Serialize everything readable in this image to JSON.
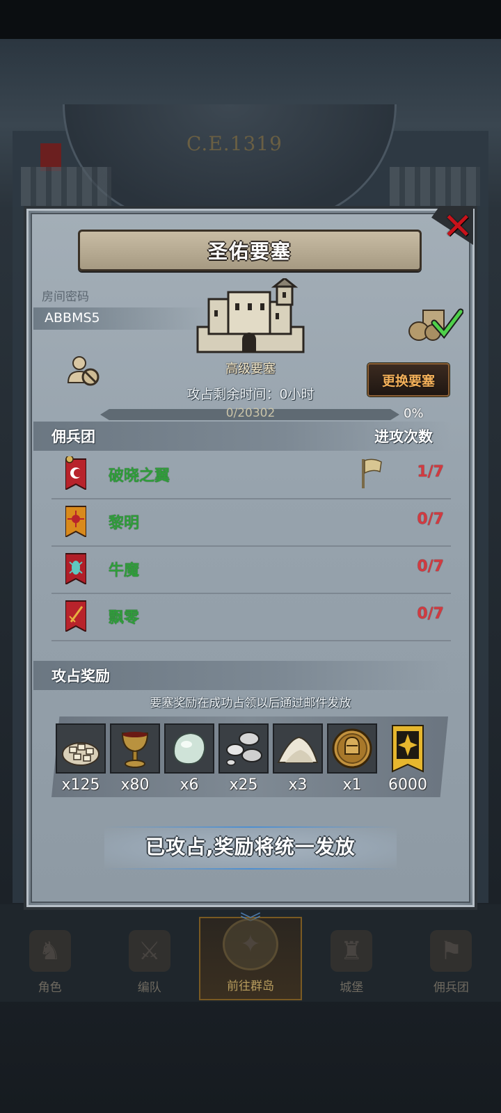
{
  "background": {
    "year": "C.E.1319"
  },
  "dialog": {
    "title": "圣佑要塞",
    "room_label": "房间密码",
    "room_code": "ABBMS5",
    "fortress_type": "高级要塞",
    "change_button": "更换要塞",
    "timer_text": "攻占剩余时间：0小时",
    "progress": {
      "text": "0/20302",
      "percent_text": "0%",
      "fraction": 0
    },
    "mercenary_header": "佣兵团",
    "attack_count_header": "进攻次数",
    "mercenaries": [
      {
        "name": "破晓之翼",
        "count": "1/7",
        "banner": "red-crescent-banner-icon",
        "color": "#b8232b",
        "has_flag": true
      },
      {
        "name": "黎明",
        "count": "0/7",
        "banner": "orange-sun-banner-icon",
        "color": "#d98a1c",
        "has_flag": false
      },
      {
        "name": "牛魔",
        "count": "0/7",
        "banner": "red-beetle-banner-icon",
        "color": "#b01e28",
        "has_flag": false
      },
      {
        "name": "飘零",
        "count": "0/7",
        "banner": "red-sword-banner-icon",
        "color": "#b8232b",
        "has_flag": false
      }
    ],
    "reward_header": "攻占奖励",
    "reward_note": "要塞奖励在成功占领以后通过邮件发放",
    "rewards": [
      {
        "icon": "bread-pile-icon",
        "qty": "x125"
      },
      {
        "icon": "goblet-icon",
        "qty": "x80"
      },
      {
        "icon": "pale-gem-icon",
        "qty": "x6"
      },
      {
        "icon": "silver-ingots-icon",
        "qty": "x25"
      },
      {
        "icon": "salt-pile-icon",
        "qty": "x3"
      },
      {
        "icon": "knight-helmet-coin-icon",
        "qty": "x1"
      },
      {
        "icon": "gold-banner-icon",
        "qty": "6000"
      }
    ],
    "occupied_text": "已攻占,奖励将统一发放"
  },
  "bottom_nav": [
    {
      "label": "角色",
      "icon": "character-icon",
      "active": false
    },
    {
      "label": "编队",
      "icon": "formation-icon",
      "active": false
    },
    {
      "label": "前往群岛",
      "icon": "islands-icon",
      "active": true
    },
    {
      "label": "城堡",
      "icon": "castle-icon",
      "active": false
    },
    {
      "label": "佣兵团",
      "icon": "mercenary-icon",
      "active": false
    }
  ],
  "colors": {
    "accent_gold": "#c9a44b",
    "merc_name_green": "#2f9d3a",
    "count_red": "#d23a40",
    "close_red": "#c8121a"
  }
}
